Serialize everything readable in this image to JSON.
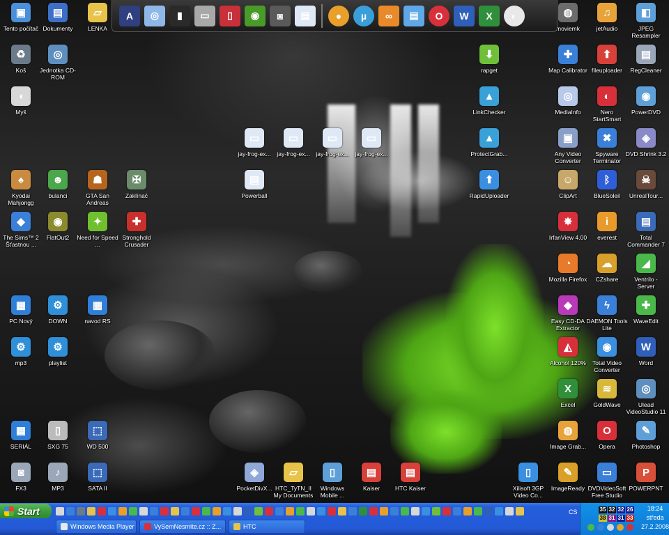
{
  "desktop_icons": [
    {
      "id": "tento-pocitac",
      "label": "Tento počítač",
      "color": "#4a8fd8",
      "glyph": "▣"
    },
    {
      "id": "dokumenty",
      "label": "Dokumenty",
      "color": "#3d6fc7",
      "glyph": "▤"
    },
    {
      "id": "lenka",
      "label": "LENKA",
      "color": "#e8c34a",
      "glyph": "▱"
    },
    {
      "id": "kos",
      "label": "Koš",
      "color": "#6c7b8a",
      "glyph": "♻"
    },
    {
      "id": "jednotka-cd-rom",
      "label": "Jednotka CD-ROM",
      "color": "#5f8fbf",
      "glyph": "◎"
    },
    {
      "id": "mys",
      "label": "Myš",
      "color": "#d8d8d8",
      "glyph": "◖"
    },
    {
      "id": "kyodai",
      "label": "Kyodai Mahjongg",
      "color": "#c98b3f",
      "glyph": "♠"
    },
    {
      "id": "bulanci",
      "label": "bulanci",
      "color": "#4ca64c",
      "glyph": "☻"
    },
    {
      "id": "gta",
      "label": "GTA San Andreas",
      "color": "#b5651d",
      "glyph": "☗"
    },
    {
      "id": "zaklinac",
      "label": "Zaklínač",
      "color": "#6a8c6a",
      "glyph": "✠"
    },
    {
      "id": "sims",
      "label": "The Sims™ 2 Šťastnou ...",
      "color": "#3a7fd8",
      "glyph": "◆"
    },
    {
      "id": "flatout",
      "label": "FlatOut2",
      "color": "#8a8a2f",
      "glyph": "◉"
    },
    {
      "id": "nfs",
      "label": "Need for Speed ...",
      "color": "#6fbf2f",
      "glyph": "✦"
    },
    {
      "id": "stronghold",
      "label": "Stronghold Crusader",
      "color": "#c8302e",
      "glyph": "✚"
    },
    {
      "id": "pc-novy",
      "label": "PC Nový",
      "color": "#2f7fd8",
      "glyph": "▦"
    },
    {
      "id": "down",
      "label": "DOWN",
      "color": "#2f8fd8",
      "glyph": "⚙"
    },
    {
      "id": "navod",
      "label": "navod RS",
      "color": "#2f7fd8",
      "glyph": "▦"
    },
    {
      "id": "mp3",
      "label": "mp3",
      "color": "#2f8fd8",
      "glyph": "⚙"
    },
    {
      "id": "playlist",
      "label": "playlist",
      "color": "#2f8fd8",
      "glyph": "⚙"
    },
    {
      "id": "serial",
      "label": "SERIÁL",
      "color": "#2f7fd8",
      "glyph": "▦"
    },
    {
      "id": "sxg75",
      "label": "SXG 75",
      "color": "#bbbbbb",
      "glyph": "▯"
    },
    {
      "id": "wd500",
      "label": "WD 500",
      "color": "#3a6ab8",
      "glyph": "⬚"
    },
    {
      "id": "fx3",
      "label": "FX3",
      "color": "#9aa7b8",
      "glyph": "◙"
    },
    {
      "id": "mp3-2",
      "label": "MP3",
      "color": "#9aa7b8",
      "glyph": "♪"
    },
    {
      "id": "sata",
      "label": "SATA II",
      "color": "#3a6ab8",
      "glyph": "⬚"
    },
    {
      "id": "jay1",
      "label": "jay-frog-ex...",
      "color": "#dfe8f5",
      "glyph": "▭"
    },
    {
      "id": "jay2",
      "label": "jay-frog-ex...",
      "color": "#dfe8f5",
      "glyph": "▭"
    },
    {
      "id": "jay3",
      "label": "jay-frog-ex...",
      "color": "#dfe8f5",
      "glyph": "▭"
    },
    {
      "id": "jay4",
      "label": "jay-frog-ex...",
      "color": "#dfe8f5",
      "glyph": "▭"
    },
    {
      "id": "powerball",
      "label": "Powerball",
      "color": "#dfe8f5",
      "glyph": "▤"
    },
    {
      "id": "pocketdivx",
      "label": "PocketDivX...",
      "color": "#8fa8d8",
      "glyph": "◈"
    },
    {
      "id": "htc-mydocs",
      "label": "HTC_TyTN_II My Documents",
      "color": "#e8c34a",
      "glyph": "▱"
    },
    {
      "id": "wm-mobile",
      "label": "Windows Mobile ...",
      "color": "#5f9fd8",
      "glyph": "▯"
    },
    {
      "id": "kaiser",
      "label": "Kaiser",
      "color": "#d8403a",
      "glyph": "▤"
    },
    {
      "id": "htc-kaiser",
      "label": "HTC Kaiser",
      "color": "#d8403a",
      "glyph": "▤"
    },
    {
      "id": "rapget",
      "label": "rapget",
      "color": "#6fbf3a",
      "glyph": "⬇"
    },
    {
      "id": "linkchecker",
      "label": "LinkChecker",
      "color": "#3aa0d8",
      "glyph": "▲"
    },
    {
      "id": "protectgrab",
      "label": "ProtectGrab...",
      "color": "#3aa0d8",
      "glyph": "▲"
    },
    {
      "id": "rapiduploader",
      "label": "RapidUploader",
      "color": "#3a8fe0",
      "glyph": "⬆"
    },
    {
      "id": "moviemk",
      "label": "moviemk",
      "color": "#6c6c6c",
      "glyph": "◍"
    },
    {
      "id": "jetaudio",
      "label": "jetAudio",
      "color": "#e8a23a",
      "glyph": "♫"
    },
    {
      "id": "jpeg-resampler",
      "label": "JPEG Resampler",
      "color": "#5f9fd8",
      "glyph": "◧"
    },
    {
      "id": "map-calibrator",
      "label": "Map Calibrator",
      "color": "#3a7fd8",
      "glyph": "✚"
    },
    {
      "id": "fileuploader",
      "label": "fileuploader",
      "color": "#d8403a",
      "glyph": "⬆"
    },
    {
      "id": "regcleaner",
      "label": "RegCleaner",
      "color": "#9aa7b8",
      "glyph": "▤"
    },
    {
      "id": "mediainfo",
      "label": "MediaInfo",
      "color": "#b8c8e8",
      "glyph": "◎"
    },
    {
      "id": "nero",
      "label": "Nero StartSmart",
      "color": "#d8303a",
      "glyph": "◐"
    },
    {
      "id": "powerdvd",
      "label": "PowerDVD",
      "color": "#5f9fd8",
      "glyph": "◉"
    },
    {
      "id": "any-video",
      "label": "Any Video Converter",
      "color": "#8a9fc8",
      "glyph": "▣"
    },
    {
      "id": "spyware",
      "label": "Spyware Terminator",
      "color": "#3a7fd8",
      "glyph": "✖"
    },
    {
      "id": "dvdshrink",
      "label": "DVD Shrink 3.2",
      "color": "#8a8ac8",
      "glyph": "◈"
    },
    {
      "id": "clipart",
      "label": "ClipArt",
      "color": "#c8a86a",
      "glyph": "☺"
    },
    {
      "id": "bluesoleil",
      "label": "BlueSoleil",
      "color": "#2f5fd8",
      "glyph": "ᛒ"
    },
    {
      "id": "unrealtour",
      "label": "UnrealTour...",
      "color": "#6a4a3a",
      "glyph": "☠"
    },
    {
      "id": "irfanview",
      "label": "IrfanView 4.00",
      "color": "#d8303a",
      "glyph": "✸"
    },
    {
      "id": "everest",
      "label": "everest",
      "color": "#e89a2a",
      "glyph": "i"
    },
    {
      "id": "total-commander",
      "label": "Total Commander 7",
      "color": "#3a6ab8",
      "glyph": "▤"
    },
    {
      "id": "firefox",
      "label": "Mozilla Firefox",
      "color": "#e87a2a",
      "glyph": "◔"
    },
    {
      "id": "czshare",
      "label": "CZshare",
      "color": "#d8a02a",
      "glyph": "☁"
    },
    {
      "id": "ventrilo",
      "label": "Ventrilo - Server",
      "color": "#4ab84a",
      "glyph": "◢"
    },
    {
      "id": "easy-cd-da",
      "label": "Easy CD-DA Extractor",
      "color": "#b83ab8",
      "glyph": "◆"
    },
    {
      "id": "daemon",
      "label": "DAEMON Tools Lite",
      "color": "#3a7fd8",
      "glyph": "ϟ"
    },
    {
      "id": "waveedit",
      "label": "WaveEdit",
      "color": "#4ab84a",
      "glyph": "✚"
    },
    {
      "id": "alcohol",
      "label": "Alcohol 120%",
      "color": "#d8303a",
      "glyph": "◭"
    },
    {
      "id": "total-video",
      "label": "Total Video Converter",
      "color": "#3a8fe0",
      "glyph": "◉"
    },
    {
      "id": "word",
      "label": "Word",
      "color": "#2f5fb8",
      "glyph": "W"
    },
    {
      "id": "excel",
      "label": "Excel",
      "color": "#2f8f3a",
      "glyph": "X"
    },
    {
      "id": "goldwave",
      "label": "GoldWave",
      "color": "#d8b83a",
      "glyph": "≋"
    },
    {
      "id": "ulead",
      "label": "Ulead VideoStudio 11",
      "color": "#5f8fbf",
      "glyph": "◎"
    },
    {
      "id": "image-grab",
      "label": "Image Grab...",
      "color": "#e8a23a",
      "glyph": "◍"
    },
    {
      "id": "opera",
      "label": "Opera",
      "color": "#d8303a",
      "glyph": "O"
    },
    {
      "id": "photoshop",
      "label": "Photoshop",
      "color": "#5f9fd8",
      "glyph": "✎"
    },
    {
      "id": "xilisoft",
      "label": "Xilisoft 3GP Video Co...",
      "color": "#3a8fe0",
      "glyph": "▯"
    },
    {
      "id": "imageready",
      "label": "ImageReady",
      "color": "#d8a02a",
      "glyph": "✎"
    },
    {
      "id": "dvdvideosoft",
      "label": "DVDVideoSoft Free Studio",
      "color": "#3a7fd8",
      "glyph": "▭"
    },
    {
      "id": "powerpnt",
      "label": "POWERPNT",
      "color": "#d8503a",
      "glyph": "P"
    }
  ],
  "top_launcher": [
    {
      "id": "amd",
      "color": "#2f3f7f",
      "glyph": "A"
    },
    {
      "id": "cd",
      "color": "#8fb8e8",
      "glyph": "◎"
    },
    {
      "id": "sidebar",
      "color": "#2a2a2a",
      "glyph": "▮"
    },
    {
      "id": "case",
      "color": "#a8a8a8",
      "glyph": "▭"
    },
    {
      "id": "ipod",
      "color": "#c8303a",
      "glyph": "▯"
    },
    {
      "id": "nvidia",
      "color": "#4a9a2a",
      "glyph": "◉"
    },
    {
      "id": "camera",
      "color": "#5a5a5a",
      "glyph": "◙"
    },
    {
      "id": "film",
      "color": "#dfe8f5",
      "glyph": "▤"
    },
    {
      "id": "orb",
      "color": "#e8a02a",
      "glyph": "●"
    },
    {
      "id": "utorrent",
      "color": "#3a9fd8",
      "glyph": "µ"
    },
    {
      "id": "link",
      "color": "#e88a2a",
      "glyph": "∞"
    },
    {
      "id": "notepad",
      "color": "#5fa8e8",
      "glyph": "▤"
    },
    {
      "id": "opera-top",
      "color": "#d8303a",
      "glyph": "O"
    },
    {
      "id": "word-top",
      "color": "#2f5fb8",
      "glyph": "W"
    },
    {
      "id": "excel-top",
      "color": "#2f8f3a",
      "glyph": "X"
    },
    {
      "id": "nero-top",
      "color": "#e8e8e8",
      "glyph": "◐"
    }
  ],
  "taskbar": {
    "start_label": "Start",
    "tasks": [
      {
        "label": "Windows Media Player",
        "color": "#e8e8e8"
      },
      {
        "label": "VySemNesmite.cz :: Z...",
        "color": "#d8303a"
      },
      {
        "label": "HTC",
        "color": "#e8c34a"
      }
    ],
    "language": "CS",
    "clock_time": "18:24",
    "clock_day": "středa",
    "clock_date": "27.2.2008",
    "tray_numbers": [
      "35",
      "32",
      "32",
      "26",
      "38",
      "31",
      "31",
      "33"
    ],
    "quicklaunch_colors": [
      "#d8d8d8",
      "#3a7fd8",
      "#6c7b8a",
      "#e8c34a",
      "#d8303a",
      "#3a8fe0",
      "#e8a02a",
      "#4ab84a",
      "#d8d8d8",
      "#3a7fd8",
      "#d8303a",
      "#e8c34a",
      "#3a7fd8",
      "#d8303a",
      "#4ab84a",
      "#e8a02a",
      "#3a8fe0",
      "#d8d8d8",
      "#2f5fb8",
      "#6fbf3a",
      "#d8303a",
      "#3a7fd8",
      "#e8a02a",
      "#4ab84a",
      "#d8d8d8",
      "#3a8fe0",
      "#d8303a",
      "#e8c34a",
      "#3a7fd8",
      "#2f8f3a",
      "#d8303a",
      "#e8a02a",
      "#3a7fd8",
      "#4ab84a",
      "#d8d8d8",
      "#3a8fe0",
      "#6fbf3a",
      "#d8303a",
      "#3a7fd8",
      "#e8a02a",
      "#4ab84a",
      "#2f5fb8",
      "#3a8fe0",
      "#d8d8d8",
      "#e8c34a"
    ]
  }
}
